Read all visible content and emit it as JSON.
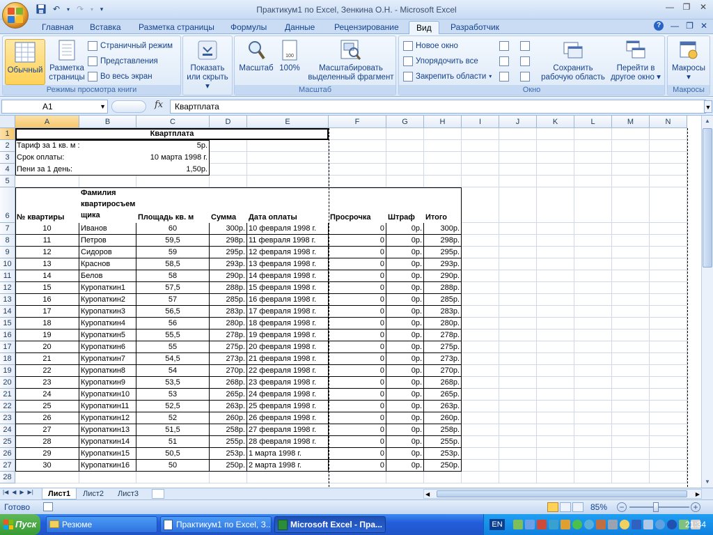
{
  "window": {
    "title": "Практикум1 по Excel, Зенкина О.Н. - Microsoft Excel"
  },
  "tabs": [
    "Главная",
    "Вставка",
    "Разметка страницы",
    "Формулы",
    "Данные",
    "Рецензирование",
    "Вид",
    "Разработчик"
  ],
  "active_tab": "Вид",
  "ribbon": {
    "views": {
      "normal": "Обычный",
      "page_layout_1": "Разметка",
      "page_layout_2": "страницы",
      "page_break": "Страничный режим",
      "custom_views": "Представления",
      "full_screen": "Во весь экран",
      "label": "Режимы просмотра книги"
    },
    "show": {
      "l1": "Показать",
      "l2": "или скрыть"
    },
    "zoom": {
      "zoom": "Масштаб",
      "z100": "100%",
      "sel1": "Масштабировать",
      "sel2": "выделенный фрагмент",
      "label": "Масштаб"
    },
    "window": {
      "new": "Новое окно",
      "arrange": "Упорядочить все",
      "freeze": "Закрепить области",
      "save1": "Сохранить",
      "save2": "рабочую область",
      "switch1": "Перейти в",
      "switch2": "другое окно",
      "label": "Окно"
    },
    "macros": {
      "btn": "Макросы",
      "label": "Макросы"
    }
  },
  "formula_bar": {
    "name": "A1",
    "fx": "fx",
    "content": "Квартплата"
  },
  "columns": [
    "A",
    "B",
    "C",
    "D",
    "E",
    "F",
    "G",
    "H",
    "I",
    "J",
    "K",
    "L",
    "M",
    "N"
  ],
  "rows": [
    "1",
    "2",
    "3",
    "4",
    "5",
    "6",
    "7",
    "8",
    "9",
    "10",
    "11",
    "12",
    "13",
    "14",
    "15",
    "16",
    "17",
    "18",
    "19",
    "20",
    "21",
    "22",
    "23",
    "24",
    "25",
    "26",
    "27",
    "28"
  ],
  "sheet": {
    "title": "Квартплата",
    "tariff_label": "Тариф за 1 кв. м :",
    "tariff_value": "5р.",
    "due_label": "Срок оплаты:",
    "due_value": "10 марта 1998 г.",
    "penalty_label": "Пени за 1 день:",
    "penalty_value": "1,50р.",
    "headers": {
      "apt": "№ квартиры",
      "name1": "Фамилия",
      "name2": "квартиросъем",
      "name3": "щика",
      "area": "Площадь кв. м",
      "sum": "Сумма",
      "date": "Дата оплаты",
      "delay": "Просрочка",
      "fine": "Штраф",
      "total": "Итого"
    },
    "table": [
      [
        "10",
        "Иванов",
        "60",
        "300р.",
        "10 февраля 1998 г.",
        "0",
        "0р.",
        "300р."
      ],
      [
        "11",
        "Петров",
        "59,5",
        "298р.",
        "11 февраля 1998 г.",
        "0",
        "0р.",
        "298р."
      ],
      [
        "12",
        "Сидоров",
        "59",
        "295р.",
        "12 февраля 1998 г.",
        "0",
        "0р.",
        "295р."
      ],
      [
        "13",
        "Краснов",
        "58,5",
        "293р.",
        "13 февраля 1998 г.",
        "0",
        "0р.",
        "293р."
      ],
      [
        "14",
        "Белов",
        "58",
        "290р.",
        "14 февраля 1998 г.",
        "0",
        "0р.",
        "290р."
      ],
      [
        "15",
        "Куропаткин1",
        "57,5",
        "288р.",
        "15 февраля 1998 г.",
        "0",
        "0р.",
        "288р."
      ],
      [
        "16",
        "Куропаткин2",
        "57",
        "285р.",
        "16 февраля 1998 г.",
        "0",
        "0р.",
        "285р."
      ],
      [
        "17",
        "Куропаткин3",
        "56,5",
        "283р.",
        "17 февраля 1998 г.",
        "0",
        "0р.",
        "283р."
      ],
      [
        "18",
        "Куропаткин4",
        "56",
        "280р.",
        "18 февраля 1998 г.",
        "0",
        "0р.",
        "280р."
      ],
      [
        "19",
        "Куропаткин5",
        "55,5",
        "278р.",
        "19 февраля 1998 г.",
        "0",
        "0р.",
        "278р."
      ],
      [
        "20",
        "Куропаткин6",
        "55",
        "275р.",
        "20 февраля 1998 г.",
        "0",
        "0р.",
        "275р."
      ],
      [
        "21",
        "Куропаткин7",
        "54,5",
        "273р.",
        "21 февраля 1998 г.",
        "0",
        "0р.",
        "273р."
      ],
      [
        "22",
        "Куропаткин8",
        "54",
        "270р.",
        "22 февраля 1998 г.",
        "0",
        "0р.",
        "270р."
      ],
      [
        "23",
        "Куропаткин9",
        "53,5",
        "268р.",
        "23 февраля 1998 г.",
        "0",
        "0р.",
        "268р."
      ],
      [
        "24",
        "Куропаткин10",
        "53",
        "265р.",
        "24 февраля 1998 г.",
        "0",
        "0р.",
        "265р."
      ],
      [
        "25",
        "Куропаткин11",
        "52,5",
        "263р.",
        "25 февраля 1998 г.",
        "0",
        "0р.",
        "263р."
      ],
      [
        "26",
        "Куропаткин12",
        "52",
        "260р.",
        "26 февраля 1998 г.",
        "0",
        "0р.",
        "260р."
      ],
      [
        "27",
        "Куропаткин13",
        "51,5",
        "258р.",
        "27 февраля 1998 г.",
        "0",
        "0р.",
        "258р."
      ],
      [
        "28",
        "Куропаткин14",
        "51",
        "255р.",
        "28 февраля 1998 г.",
        "0",
        "0р.",
        "255р."
      ],
      [
        "29",
        "Куропаткин15",
        "50,5",
        "253р.",
        "1 марта 1998 г.",
        "0",
        "0р.",
        "253р."
      ],
      [
        "30",
        "Куропаткин16",
        "50",
        "250р.",
        "2 марта 1998 г.",
        "0",
        "0р.",
        "250р."
      ]
    ]
  },
  "sheet_tabs": [
    "Лист1",
    "Лист2",
    "Лист3"
  ],
  "status": {
    "ready": "Готово",
    "zoom": "85%"
  },
  "taskbar": {
    "start": "Пуск",
    "items": [
      "Резюме",
      "Практикум1 по Excel, З...",
      "Microsoft Excel - Пра..."
    ],
    "lang": "EN",
    "clock": "21:34"
  }
}
